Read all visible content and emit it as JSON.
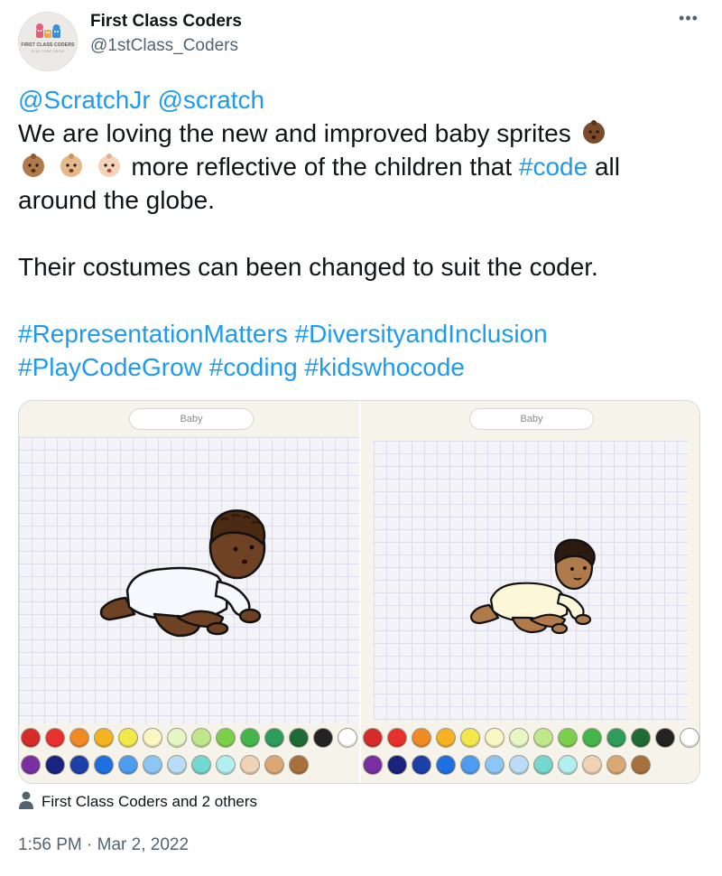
{
  "account": {
    "display_name": "First Class Coders",
    "handle": "@1stClass_Coders",
    "avatar_text": "FIRST CLASS CODERS",
    "avatar_tagline": "PLAY CODE GROW"
  },
  "menu": {
    "more_label": "•••"
  },
  "tweet": {
    "mention1": "@ScratchJr",
    "mention2": "@scratch",
    "line1": "We are loving the new and improved baby sprites",
    "line2_text": " more reflective of the children that ",
    "hashtag_code": "#code",
    "line2_tail": " all",
    "line3": "around the globe.",
    "para2": "Their costumes can been changed to suit the coder.",
    "hashtags_line1a": "#RepresentationMatters",
    "hashtags_line1b": "#DiversityandInclusion",
    "hashtags_line2a": "#PlayCodeGrow",
    "hashtags_line2b": "#coding",
    "hashtags_line2c": "#kidswhocode",
    "emojis": [
      "baby-dark-skin-tone",
      "baby-medium-skin-tone",
      "baby-medium-light-skin-tone",
      "baby-light-skin-tone"
    ]
  },
  "media": {
    "left_panel": {
      "sprite_name": "Baby"
    },
    "right_panel": {
      "sprite_name": "Baby"
    },
    "palette_row1": [
      "#d62b2b",
      "#e8302d",
      "#f08a24",
      "#f5b222",
      "#f3e84a",
      "#fbf7c2",
      "#e6f7c5",
      "#bfe88a",
      "#7ccf4a",
      "#43b54a",
      "#2e9c5a",
      "#1f6b36",
      "#232323",
      "#ffffff"
    ],
    "palette_row2": [
      "#7a2fa0",
      "#1a237e",
      "#1d3fa8",
      "#1f6fe0",
      "#4d9cf0",
      "#8cc6f5",
      "#b9ddf7",
      "#74d8d0",
      "#b3eef0",
      "#f0d2b5",
      "#dba775",
      "#a8703c"
    ]
  },
  "social_context": {
    "text": "First Class Coders and 2 others"
  },
  "timestamp": "1:56 PM · Mar 2, 2022"
}
